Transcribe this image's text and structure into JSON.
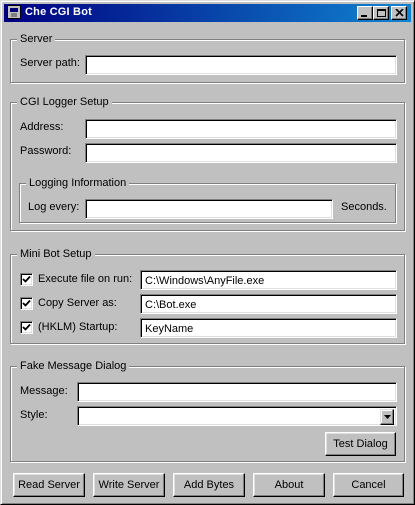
{
  "window": {
    "title": "Che CGI Bot",
    "minimize_icon": "minimize-icon",
    "maximize_icon": "maximize-icon",
    "close_icon": "close-icon"
  },
  "server": {
    "legend": "Server",
    "path_label": "Server path:",
    "path_value": ""
  },
  "cgi_logger": {
    "legend": "CGI Logger Setup",
    "address_label": "Address:",
    "address_value": "",
    "password_label": "Password:",
    "password_value": "",
    "logging": {
      "legend": "Logging Information",
      "log_every_label": "Log every:",
      "log_every_value": "",
      "seconds_label": "Seconds."
    }
  },
  "mini_bot": {
    "legend": "Mini Bot Setup",
    "options": [
      {
        "label": "Execute file on run:",
        "checked": true,
        "value": "C:\\Windows\\AnyFile.exe"
      },
      {
        "label": "Copy Server as:",
        "checked": true,
        "value": "C:\\Bot.exe"
      },
      {
        "label": "(HKLM) Startup:",
        "checked": true,
        "value": "KeyName"
      }
    ]
  },
  "fake_message": {
    "legend": "Fake Message Dialog",
    "message_label": "Message:",
    "message_value": "",
    "style_label": "Style:",
    "style_value": "",
    "test_button": "Test Dialog"
  },
  "buttons": {
    "read_server": "Read Server",
    "write_server": "Write Server",
    "add_bytes": "Add Bytes",
    "about": "About",
    "cancel": "Cancel"
  },
  "colors": {
    "face": "#c0c0c0",
    "title_active": "#000080"
  }
}
